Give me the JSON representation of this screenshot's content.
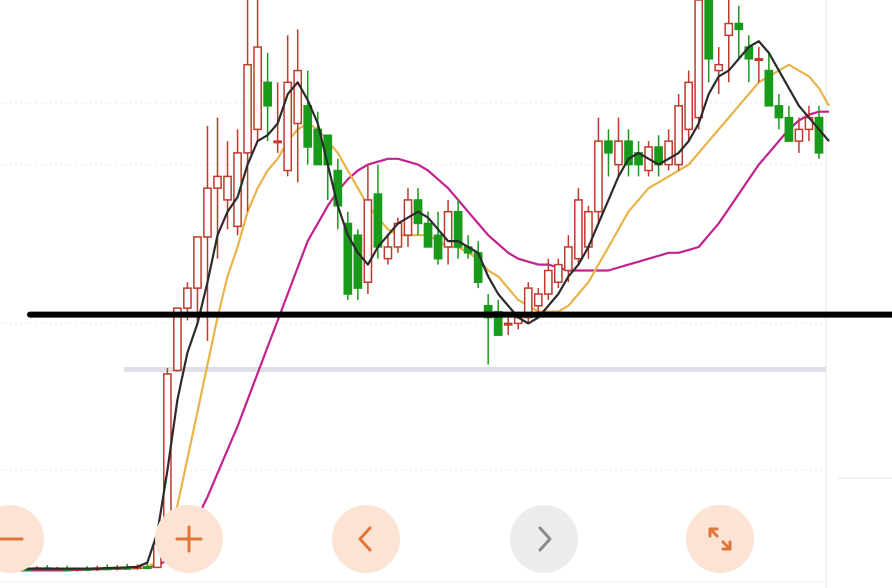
{
  "chart_data": {
    "type": "candlestick",
    "title": "",
    "xlabel": "",
    "ylabel": "",
    "ylim": [
      0,
      100
    ],
    "grid": true,
    "legend": "none",
    "up_color": "#c0392b",
    "down_color": "#1a9a1a",
    "ma_colors": {
      "ma5": "#2b2b2b",
      "ma10": "#e8b44a",
      "ma20": "#c2218f"
    },
    "support_line": {
      "y": 46.5,
      "color": "#000000"
    },
    "candles": [
      {
        "o": 3.0,
        "h": 3.6,
        "l": 2.7,
        "c": 3.3
      },
      {
        "o": 3.3,
        "h": 3.8,
        "l": 2.9,
        "c": 3.1
      },
      {
        "o": 3.1,
        "h": 3.7,
        "l": 2.8,
        "c": 3.4
      },
      {
        "o": 3.4,
        "h": 3.9,
        "l": 3.0,
        "c": 3.2
      },
      {
        "o": 3.2,
        "h": 3.6,
        "l": 2.9,
        "c": 3.3
      },
      {
        "o": 3.3,
        "h": 3.8,
        "l": 2.9,
        "c": 3.1
      },
      {
        "o": 3.1,
        "h": 3.5,
        "l": 2.8,
        "c": 3.3
      },
      {
        "o": 3.3,
        "h": 3.7,
        "l": 3.0,
        "c": 3.2
      },
      {
        "o": 3.2,
        "h": 3.8,
        "l": 2.9,
        "c": 3.4
      },
      {
        "o": 3.4,
        "h": 4.0,
        "l": 3.1,
        "c": 3.3
      },
      {
        "o": 3.3,
        "h": 3.9,
        "l": 3.0,
        "c": 3.5
      },
      {
        "o": 3.5,
        "h": 4.1,
        "l": 3.2,
        "c": 3.4
      },
      {
        "o": 3.4,
        "h": 4.0,
        "l": 3.1,
        "c": 3.6
      },
      {
        "o": 3.6,
        "h": 4.2,
        "l": 3.3,
        "c": 3.5
      },
      {
        "o": 3.5,
        "h": 8.4,
        "l": 3.4,
        "c": 7.5
      },
      {
        "o": 7.5,
        "h": 37.4,
        "l": 7.1,
        "c": 36.4
      },
      {
        "o": 37.0,
        "h": 47.6,
        "l": 36.8,
        "c": 47.6
      },
      {
        "o": 47.6,
        "h": 52.0,
        "l": 45.5,
        "c": 51.0
      },
      {
        "o": 51.0,
        "h": 58.6,
        "l": 45.0,
        "c": 59.7
      },
      {
        "o": 59.7,
        "h": 78.6,
        "l": 42.0,
        "c": 68.0
      },
      {
        "o": 68.0,
        "h": 80.0,
        "l": 56.0,
        "c": 70.0
      },
      {
        "o": 66.0,
        "h": 76.0,
        "l": 61.0,
        "c": 70.0
      },
      {
        "o": 61.5,
        "h": 78.0,
        "l": 60.0,
        "c": 74.0
      },
      {
        "o": 74.0,
        "h": 102.0,
        "l": 64.0,
        "c": 89.0
      },
      {
        "o": 78.0,
        "h": 100.0,
        "l": 76.0,
        "c": 92.0
      },
      {
        "o": 86.0,
        "h": 91.0,
        "l": 76.0,
        "c": 82.0
      },
      {
        "o": 76.0,
        "h": 86.0,
        "l": 74.0,
        "c": 76.0
      },
      {
        "o": 71.0,
        "h": 94.0,
        "l": 70.0,
        "c": 86.0
      },
      {
        "o": 79.0,
        "h": 95.0,
        "l": 69.0,
        "c": 88.0
      },
      {
        "o": 82.0,
        "h": 88.0,
        "l": 72.0,
        "c": 75.0
      },
      {
        "o": 78.0,
        "h": 81.0,
        "l": 73.0,
        "c": 72.0
      },
      {
        "o": 77.0,
        "h": 75.0,
        "l": 66.0,
        "c": 72.0
      },
      {
        "o": 71.0,
        "h": 73.0,
        "l": 61.0,
        "c": 65.0
      },
      {
        "o": 62.0,
        "h": 64.0,
        "l": 49.0,
        "c": 50.0
      },
      {
        "o": 60.0,
        "h": 61.0,
        "l": 49.0,
        "c": 51.0
      },
      {
        "o": 52.0,
        "h": 72.0,
        "l": 50.0,
        "c": 66.0
      },
      {
        "o": 67.0,
        "h": 72.0,
        "l": 56.0,
        "c": 58.0
      },
      {
        "o": 56.0,
        "h": 60.0,
        "l": 55.0,
        "c": 58.0
      },
      {
        "o": 58.0,
        "h": 63.0,
        "l": 57.0,
        "c": 62.0
      },
      {
        "o": 60.0,
        "h": 68.0,
        "l": 58.0,
        "c": 66.0
      },
      {
        "o": 66.0,
        "h": 68.0,
        "l": 60.0,
        "c": 62.0
      },
      {
        "o": 62.0,
        "h": 64.0,
        "l": 58.0,
        "c": 58.0
      },
      {
        "o": 60.0,
        "h": 64.0,
        "l": 55.0,
        "c": 56.0
      },
      {
        "o": 58.0,
        "h": 66.0,
        "l": 55.0,
        "c": 64.0
      },
      {
        "o": 64.0,
        "h": 66.0,
        "l": 56.0,
        "c": 58.0
      },
      {
        "o": 58.0,
        "h": 60.0,
        "l": 56.0,
        "c": 57.0
      },
      {
        "o": 57.0,
        "h": 59.0,
        "l": 51.0,
        "c": 52.0
      },
      {
        "o": 48.0,
        "h": 50.0,
        "l": 38.0,
        "c": 46.0
      },
      {
        "o": 47.0,
        "h": 49.0,
        "l": 43.0,
        "c": 43.0
      },
      {
        "o": 45.0,
        "h": 46.0,
        "l": 43.0,
        "c": 45.0
      },
      {
        "o": 45.0,
        "h": 47.0,
        "l": 44.0,
        "c": 46.0
      },
      {
        "o": 46.0,
        "h": 52.0,
        "l": 45.0,
        "c": 51.0
      },
      {
        "o": 48.0,
        "h": 51.0,
        "l": 47.0,
        "c": 50.0
      },
      {
        "o": 50.0,
        "h": 56.0,
        "l": 49.0,
        "c": 54.0
      },
      {
        "o": 52.0,
        "h": 56.0,
        "l": 51.0,
        "c": 55.0
      },
      {
        "o": 54.0,
        "h": 60.0,
        "l": 52.0,
        "c": 58.0
      },
      {
        "o": 56.0,
        "h": 68.0,
        "l": 55.0,
        "c": 66.0
      },
      {
        "o": 58.0,
        "h": 65.0,
        "l": 56.0,
        "c": 64.0
      },
      {
        "o": 64.0,
        "h": 80.0,
        "l": 62.0,
        "c": 76.0
      },
      {
        "o": 76.0,
        "h": 78.0,
        "l": 70.0,
        "c": 74.0
      },
      {
        "o": 72.0,
        "h": 80.0,
        "l": 70.0,
        "c": 76.0
      },
      {
        "o": 76.0,
        "h": 78.0,
        "l": 70.0,
        "c": 72.0
      },
      {
        "o": 74.0,
        "h": 76.0,
        "l": 70.0,
        "c": 72.0
      },
      {
        "o": 71.0,
        "h": 76.0,
        "l": 70.0,
        "c": 75.0
      },
      {
        "o": 75.0,
        "h": 77.0,
        "l": 70.0,
        "c": 72.0
      },
      {
        "o": 72.0,
        "h": 78.0,
        "l": 71.0,
        "c": 76.0
      },
      {
        "o": 72.0,
        "h": 84.0,
        "l": 71.0,
        "c": 82.0
      },
      {
        "o": 78.0,
        "h": 88.0,
        "l": 76.0,
        "c": 86.0
      },
      {
        "o": 80.0,
        "h": 104.0,
        "l": 78.0,
        "c": 100.0
      },
      {
        "o": 100.0,
        "h": 106.0,
        "l": 86.0,
        "c": 90.0
      },
      {
        "o": 88.0,
        "h": 92.0,
        "l": 84.0,
        "c": 89.0
      },
      {
        "o": 94.0,
        "h": 104.0,
        "l": 86.0,
        "c": 96.0
      },
      {
        "o": 96.0,
        "h": 99.0,
        "l": 90.0,
        "c": 95.0
      },
      {
        "o": 92.0,
        "h": 94.0,
        "l": 86.0,
        "c": 90.0
      },
      {
        "o": 90.0,
        "h": 92.0,
        "l": 86.0,
        "c": 90.0
      },
      {
        "o": 88.0,
        "h": 91.0,
        "l": 82.0,
        "c": 82.0
      },
      {
        "o": 82.0,
        "h": 84.0,
        "l": 78.0,
        "c": 80.0
      },
      {
        "o": 80.0,
        "h": 82.0,
        "l": 76.0,
        "c": 76.0
      },
      {
        "o": 76.0,
        "h": 80.0,
        "l": 74.0,
        "c": 78.0
      },
      {
        "o": 78.0,
        "h": 82.0,
        "l": 76.0,
        "c": 80.0
      },
      {
        "o": 80.0,
        "h": 82.0,
        "l": 73.0,
        "c": 74.0
      }
    ],
    "ma5": [
      3.3,
      3.3,
      3.3,
      3.3,
      3.3,
      3.3,
      3.3,
      3.3,
      3.3,
      3.4,
      3.4,
      3.5,
      3.6,
      4.3,
      9.4,
      20.0,
      32.0,
      40.0,
      45.0,
      52.0,
      60.0,
      64.0,
      66.5,
      72.0,
      76.0,
      77.0,
      79.0,
      84.0,
      86.0,
      83.0,
      79.0,
      72.0,
      65.0,
      60.0,
      57.0,
      55.0,
      58.0,
      60.0,
      62.0,
      63.0,
      64.0,
      63.0,
      61.0,
      59.0,
      59.0,
      58.0,
      57.0,
      53.0,
      50.0,
      48.0,
      46.0,
      45.0,
      46.0,
      48.0,
      50.0,
      53.0,
      55.0,
      58.0,
      62.0,
      66.0,
      70.0,
      73.0,
      74.0,
      73.0,
      72.0,
      73.0,
      74.0,
      76.0,
      79.0,
      84.0,
      87.0,
      88.0,
      90.0,
      92.0,
      93.0,
      91.0,
      88.0,
      85.0,
      82.0,
      80.0,
      78.0,
      76.0
    ],
    "ma10": [
      3.3,
      3.3,
      3.3,
      3.3,
      3.3,
      3.3,
      3.3,
      3.3,
      3.3,
      3.3,
      3.3,
      3.4,
      3.4,
      3.6,
      4.5,
      8.0,
      14.0,
      22.0,
      30.0,
      38.0,
      46.0,
      53.0,
      58.0,
      64.0,
      68.0,
      71.0,
      73.0,
      76.0,
      78.0,
      79.0,
      78.0,
      76.0,
      74.0,
      71.0,
      68.0,
      65.0,
      63.0,
      61.0,
      60.0,
      60.0,
      60.0,
      60.0,
      59.0,
      58.0,
      58.0,
      57.0,
      56.0,
      54.0,
      53.0,
      51.0,
      49.0,
      48.0,
      47.0,
      47.0,
      47.0,
      48.0,
      50.0,
      52.0,
      55.0,
      58.0,
      61.0,
      64.0,
      66.0,
      68.0,
      69.0,
      70.0,
      71.0,
      72.0,
      74.0,
      76.0,
      78.0,
      80.0,
      82.0,
      84.0,
      86.0,
      87.0,
      88.0,
      89.0,
      88.0,
      87.0,
      85.0,
      82.0
    ],
    "ma20": [
      3.0,
      3.0,
      3.0,
      3.0,
      3.0,
      3.0,
      3.1,
      3.1,
      3.2,
      3.2,
      3.3,
      3.3,
      3.4,
      3.5,
      3.8,
      4.8,
      6.5,
      9.0,
      12.0,
      15.5,
      19.5,
      23.5,
      27.5,
      32.0,
      36.5,
      41.0,
      45.5,
      50.0,
      54.5,
      59.0,
      62.0,
      65.0,
      67.5,
      69.5,
      71.0,
      72.0,
      72.5,
      73.0,
      73.0,
      72.5,
      72.0,
      71.0,
      69.5,
      68.0,
      66.0,
      64.0,
      62.0,
      60.0,
      58.5,
      57.0,
      56.0,
      55.5,
      55.0,
      55.0,
      54.5,
      54.0,
      54.0,
      54.0,
      54.0,
      54.0,
      54.5,
      55.0,
      55.5,
      56.0,
      56.5,
      57.0,
      57.0,
      57.5,
      58.0,
      60.0,
      62.0,
      64.5,
      67.0,
      69.5,
      72.0,
      74.0,
      76.0,
      78.0,
      79.5,
      80.5,
      81.0,
      81.0
    ]
  },
  "controls": {
    "zoom_out_icon": "minus-icon",
    "zoom_in_icon": "plus-icon",
    "prev_icon": "chevron-left-icon",
    "next_icon": "chevron-right-icon",
    "fullscreen_icon": "expand-diagonal-icon"
  }
}
